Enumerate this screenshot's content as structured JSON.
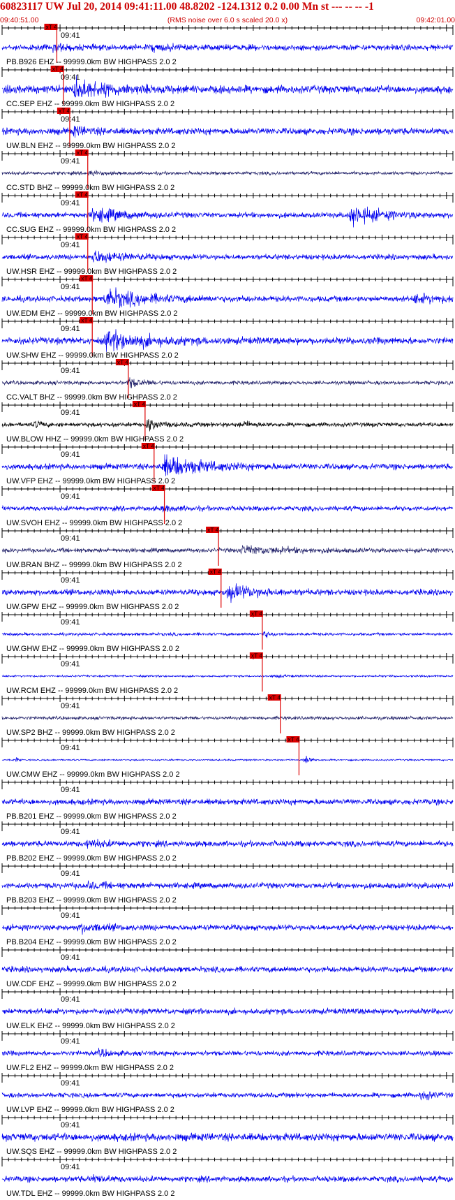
{
  "header": {
    "title": "60823117 UW Jul 20, 2014 09:41:11.00    48.8202  -124.1312  0.2 0.00 Mn st --- -- --  -1",
    "start_time": "09:40:51.00",
    "rms_note": "(RMS noise over 6.0 s scaled 20.0 x)",
    "end_time": "09:42:01.00"
  },
  "colors": {
    "trace_default": "#0000ee",
    "header_text": "#cc0000",
    "pick": "#dd0000"
  },
  "chart_data": {
    "type": "line",
    "xlim": [
      "09:40:51.00",
      "09:42:01.00"
    ],
    "minute_tick_label": "09:41",
    "minute_tick_time": "09:41:00",
    "pick_label": "xT 4",
    "traces": [
      {
        "label": "PB.B926 EHZ -- 99999.0km BW  HIGHPASS  2.0  2",
        "pick_time": "09:40:59.5",
        "color": "#0000ee",
        "amp": 0.6,
        "events": [
          [
            "09:40:59",
            0.8,
            1.5
          ],
          [
            "09:41:14",
            0.5,
            3
          ]
        ]
      },
      {
        "label": "CC.SEP EHZ -- 99999.0km BW  HIGHPASS  2.0  2",
        "pick_time": "09:41:00.5",
        "color": "#0000ee",
        "amp": 0.8,
        "events": [
          [
            "09:41:02",
            1.8,
            5
          ]
        ]
      },
      {
        "label": "UW.BLN EHZ -- 99999.0km BW  HIGHPASS  2.0  2",
        "pick_time": "09:41:01.5",
        "color": "#0000ee",
        "amp": 0.7,
        "events": [
          [
            "09:41:02",
            0.8,
            2
          ]
        ]
      },
      {
        "label": "CC.STD BHZ -- 99999.0km BW  HIGHPASS  2.0  2",
        "pick_time": "09:41:04.3",
        "color": "#22226a",
        "amp": 0.35,
        "events": [
          [
            "09:41:04.5",
            0.5,
            1.5
          ]
        ]
      },
      {
        "label": "CC.SUG EHZ -- 99999.0km BW  HIGHPASS  2.0  2",
        "pick_time": "09:41:04.3",
        "color": "#0000ee",
        "amp": 0.55,
        "events": [
          [
            "09:41:05",
            1.4,
            4
          ],
          [
            "09:41:45",
            2.0,
            4
          ]
        ]
      },
      {
        "label": "UW.HSR EHZ -- 99999.0km BW  HIGHPASS  2.0  2",
        "pick_time": "09:41:04.3",
        "color": "#0000ee",
        "amp": 0.55,
        "events": [
          [
            "09:41:05",
            1.2,
            4
          ]
        ]
      },
      {
        "label": "UW.EDM EHZ -- 99999.0km BW  HIGHPASS  2.0  2",
        "pick_time": "09:41:05.0",
        "color": "#0000ee",
        "amp": 0.6,
        "events": [
          [
            "09:41:07",
            1.8,
            6
          ],
          [
            "09:41:55",
            0.8,
            4
          ]
        ]
      },
      {
        "label": "UW.SHW EHZ -- 99999.0km BW  HIGHPASS  2.0  2",
        "pick_time": "09:41:05.0",
        "color": "#0000ee",
        "amp": 0.7,
        "events": [
          [
            "09:41:07",
            1.8,
            6
          ]
        ]
      },
      {
        "label": "CC.VALT BHZ -- 99999.0km BW  HIGHPASS  2.0  2",
        "pick_time": "09:41:10.6",
        "color": "#22226a",
        "amp": 0.4,
        "events": [
          [
            "09:41:10.5",
            1.0,
            2
          ]
        ]
      },
      {
        "label": "UW.BLOW HHZ -- 99999.0km BW  HIGHPASS  2.0  2",
        "pick_time": "09:41:13.2",
        "color": "#000000",
        "amp": 0.45,
        "events": [
          [
            "09:41:13.5",
            1.4,
            1.5
          ],
          [
            "09:40:56",
            0.7,
            1
          ],
          [
            "09:41:28",
            0.6,
            1.5
          ]
        ]
      },
      {
        "label": "UW.VFP EHZ -- 99999.0km BW  HIGHPASS  2.0  2",
        "pick_time": "09:41:14.6",
        "color": "#0000ee",
        "amp": 0.6,
        "events": [
          [
            "09:41:16",
            2.0,
            6
          ]
        ]
      },
      {
        "label": "UW.SVOH EHZ -- 99999.0km BW  HIGHPASS  2.0  2",
        "pick_time": "09:41:16.2",
        "color": "#0000ee",
        "amp": 0.5,
        "events": [
          [
            "09:41:16",
            0.5,
            2
          ]
        ]
      },
      {
        "label": "UW.BRAN BHZ -- 99999.0km BW  HIGHPASS  2.0  2",
        "pick_time": "09:41:24.6",
        "color": "#22226a",
        "amp": 0.45,
        "events": [
          [
            "09:41:28",
            0.8,
            7
          ]
        ]
      },
      {
        "label": "UW.GPW EHZ -- 99999.0km BW  HIGHPASS  2.0  2",
        "pick_time": "09:41:25.0",
        "color": "#0000ee",
        "amp": 0.6,
        "events": [
          [
            "09:41:26",
            1.5,
            4
          ]
        ]
      },
      {
        "label": "UW.GHW EHZ -- 99999.0km BW  HIGHPASS  2.0  2",
        "pick_time": "09:41:31.4",
        "color": "#0000ee",
        "amp": 0.3,
        "events": [
          [
            "09:41:31.5",
            0.9,
            0.8
          ]
        ]
      },
      {
        "label": "UW.RCM EHZ -- 99999.0km BW  HIGHPASS  2.0  2",
        "pick_time": "09:41:31.4",
        "color": "#0000ee",
        "amp": 0.2,
        "events": [
          [
            "09:41:33",
            0.3,
            2
          ]
        ]
      },
      {
        "label": "UW.SP2 BHZ -- 99999.0km BW  HIGHPASS  2.0  2",
        "pick_time": "09:41:34.2",
        "color": "#22226a",
        "amp": 0.35,
        "events": []
      },
      {
        "label": "UW.CMW EHZ -- 99999.0km BW  HIGHPASS  2.0  2",
        "pick_time": "09:41:37.1",
        "color": "#0000ee",
        "amp": 0.15,
        "events": [
          [
            "09:41:38",
            1.6,
            0.6
          ],
          [
            "09:40:53",
            1.0,
            0.3
          ]
        ]
      },
      {
        "label": "PB.B201 EHZ -- 99999.0km BW  HIGHPASS  2.0  2",
        "pick_time": null,
        "color": "#0000ee",
        "amp": 0.6,
        "events": []
      },
      {
        "label": "PB.B202 EHZ -- 99999.0km BW  HIGHPASS  2.0  2",
        "pick_time": null,
        "color": "#0000ee",
        "amp": 0.6,
        "events": [
          [
            "09:41:04",
            0.6,
            3
          ]
        ]
      },
      {
        "label": "PB.B203 EHZ -- 99999.0km BW  HIGHPASS  2.0  2",
        "pick_time": null,
        "color": "#0000ee",
        "amp": 0.6,
        "events": [
          [
            "09:41:04",
            0.5,
            3
          ]
        ]
      },
      {
        "label": "PB.B204 EHZ -- 99999.0km BW  HIGHPASS  2.0  2",
        "pick_time": null,
        "color": "#0000ee",
        "amp": 0.6,
        "events": [
          [
            "09:41:03",
            0.8,
            3
          ]
        ]
      },
      {
        "label": "UW.CDF EHZ -- 99999.0km BW  HIGHPASS  2.0  2",
        "pick_time": null,
        "color": "#0000ee",
        "amp": 0.6,
        "events": []
      },
      {
        "label": "UW.ELK EHZ -- 99999.0km BW  HIGHPASS  2.0  2",
        "pick_time": null,
        "color": "#0000ee",
        "amp": 0.6,
        "events": []
      },
      {
        "label": "UW.FL2 EHZ -- 99999.0km BW  HIGHPASS  2.0  2",
        "pick_time": null,
        "color": "#0000ee",
        "amp": 0.5,
        "events": [
          [
            "09:41:06",
            0.7,
            1.5
          ]
        ]
      },
      {
        "label": "UW.LVP EHZ -- 99999.0km BW  HIGHPASS  2.0  2",
        "pick_time": null,
        "color": "#0000ee",
        "amp": 0.5,
        "events": [
          [
            "09:41:56",
            1.0,
            1.5
          ]
        ]
      },
      {
        "label": "UW.SQS EHZ -- 99999.0km BW  HIGHPASS  2.0  2",
        "pick_time": null,
        "color": "#0000ee",
        "amp": 0.8,
        "events": []
      },
      {
        "label": "UW.TDL EHZ -- 99999.0km BW  HIGHPASS  2.0  2",
        "pick_time": null,
        "color": "#0000ee",
        "amp": 0.6,
        "events": [
          [
            "09:41:05",
            0.6,
            2
          ]
        ]
      }
    ]
  }
}
